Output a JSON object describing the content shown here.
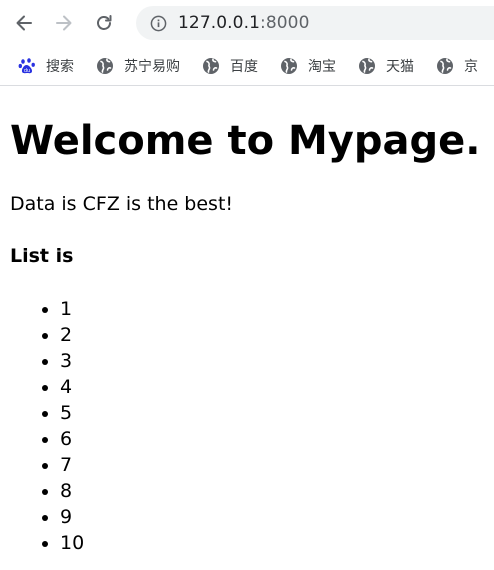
{
  "browser": {
    "url_host": "127.0.0.1",
    "url_port": ":8000",
    "icons": {
      "back": "back-arrow-icon",
      "forward": "forward-arrow-icon",
      "reload": "reload-icon",
      "info": "info-icon"
    }
  },
  "bookmarks": [
    {
      "label": "搜索",
      "icon": "baidu-paw-icon"
    },
    {
      "label": "苏宁易购",
      "icon": "globe-icon"
    },
    {
      "label": "百度",
      "icon": "globe-icon"
    },
    {
      "label": "淘宝",
      "icon": "globe-icon"
    },
    {
      "label": "天猫",
      "icon": "globe-icon"
    },
    {
      "label": "京",
      "icon": "globe-icon"
    }
  ],
  "page": {
    "heading": "Welcome to Mypage.",
    "data_text": "Data is CFZ is the best!",
    "list_title": "List is",
    "list_items": [
      "1",
      "2",
      "3",
      "4",
      "5",
      "6",
      "7",
      "8",
      "9",
      "10"
    ]
  }
}
